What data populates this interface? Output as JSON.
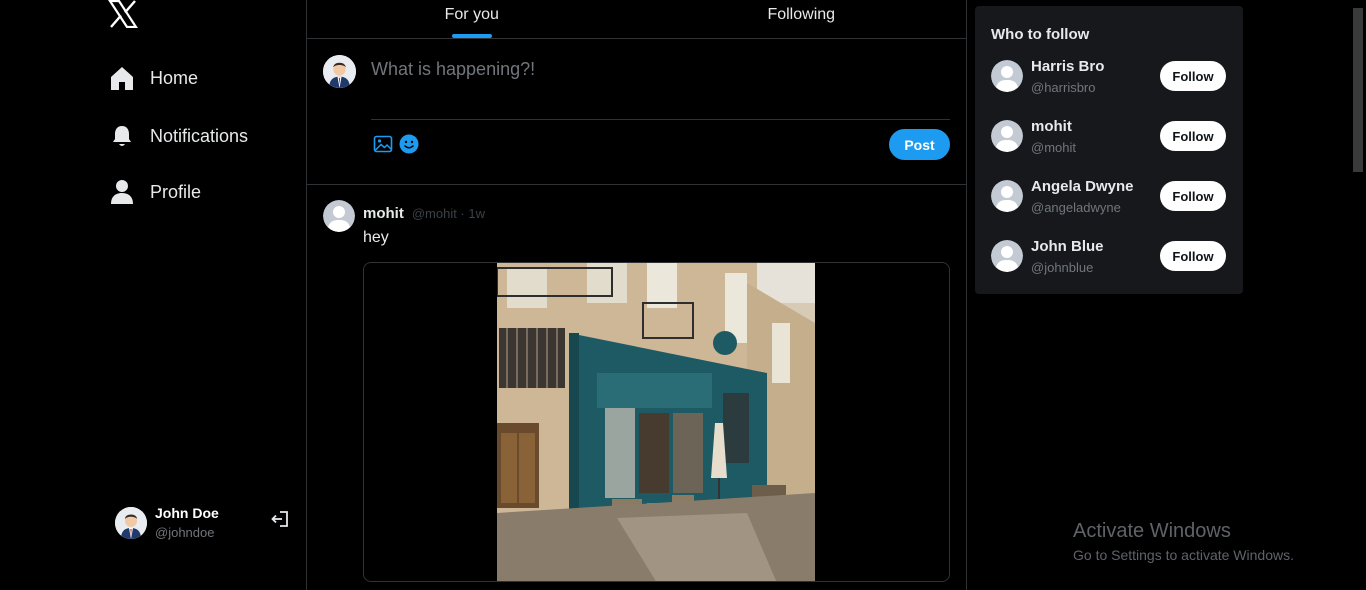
{
  "sidebar": {
    "logo": "x-logo-icon",
    "nav": [
      {
        "label": "Home",
        "icon": "home-icon"
      },
      {
        "label": "Notifications",
        "icon": "bell-icon"
      },
      {
        "label": "Profile",
        "icon": "user-icon"
      }
    ],
    "user": {
      "name": "John Doe",
      "handle": "@johndoe"
    }
  },
  "tabs": [
    {
      "label": "For you",
      "active": true
    },
    {
      "label": "Following",
      "active": false
    }
  ],
  "composer": {
    "placeholder": "What is happening?!",
    "post_label": "Post"
  },
  "feed": [
    {
      "name": "mohit",
      "meta": "@mohit · 1w",
      "text": "hey",
      "has_image": true
    }
  ],
  "who_to_follow": {
    "title": "Who to follow",
    "items": [
      {
        "name": "Harris Bro",
        "handle": "@harrisbro",
        "button": "Follow"
      },
      {
        "name": "mohit",
        "handle": "@mohit",
        "button": "Follow"
      },
      {
        "name": "Angela Dwyne",
        "handle": "@angeladwyne",
        "button": "Follow"
      },
      {
        "name": "John Blue",
        "handle": "@johnblue",
        "button": "Follow"
      }
    ]
  },
  "watermark": {
    "title": "Activate Windows",
    "subtitle": "Go to Settings to activate Windows."
  },
  "colors": {
    "accent": "#1d9bf0",
    "background": "#000000",
    "card": "#16181c",
    "border": "#2f3336",
    "muted": "#71767b"
  }
}
